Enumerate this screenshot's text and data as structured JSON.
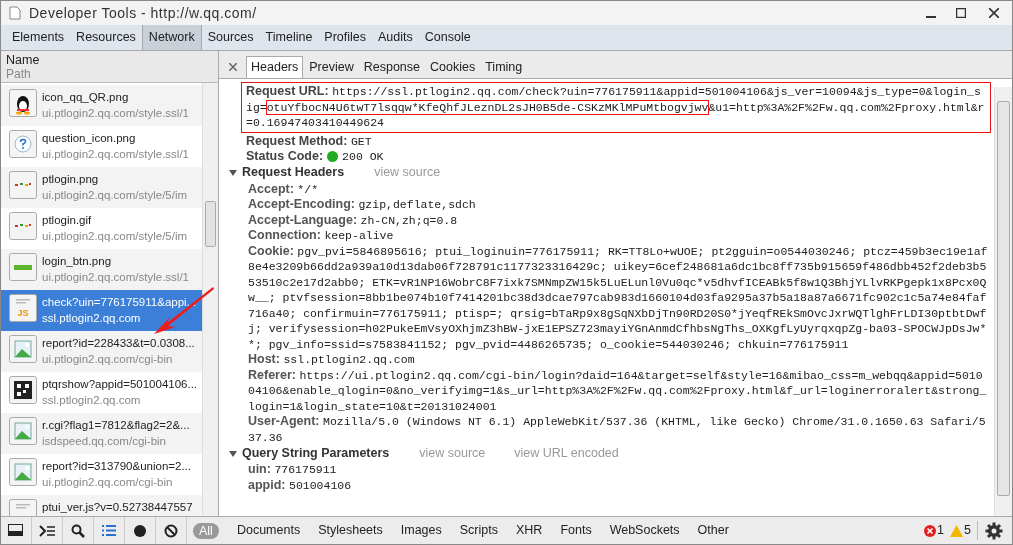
{
  "window": {
    "title": "Developer Tools - http://w.qq.com/"
  },
  "tabs": [
    {
      "label": "Elements",
      "selected": false
    },
    {
      "label": "Resources",
      "selected": false
    },
    {
      "label": "Network",
      "selected": true
    },
    {
      "label": "Sources",
      "selected": false
    },
    {
      "label": "Timeline",
      "selected": false
    },
    {
      "label": "Profiles",
      "selected": false
    },
    {
      "label": "Audits",
      "selected": false
    },
    {
      "label": "Console",
      "selected": false
    }
  ],
  "requests": {
    "header_name": "Name",
    "header_path": "Path",
    "items": [
      {
        "kind": "penguin",
        "name": "icon_qq_QR.png",
        "path": "ui.ptlogin2.qq.com/style.ssl/1",
        "selected": false
      },
      {
        "kind": "question",
        "name": "question_icon.png",
        "path": "ui.ptlogin2.qq.com/style.ssl/1",
        "selected": false
      },
      {
        "kind": "sprite",
        "name": "ptlogin.png",
        "path": "ui.ptlogin2.qq.com/style/5/im",
        "selected": false
      },
      {
        "kind": "sprite",
        "name": "ptlogin.gif",
        "path": "ui.ptlogin2.qq.com/style/5/im",
        "selected": false
      },
      {
        "kind": "bar",
        "name": "login_btn.png",
        "path": "ui.ptlogin2.qq.com/style.ssl/1",
        "selected": false
      },
      {
        "kind": "script",
        "icon_text": "JS",
        "name": "check?uin=776175911&appi...",
        "path": "ssl.ptlogin2.qq.com",
        "selected": true
      },
      {
        "kind": "image",
        "name": "report?id=228433&t=0.0308...",
        "path": "ui.ptlogin2.qq.com/cgi-bin",
        "selected": false
      },
      {
        "kind": "qr",
        "name": "ptqrshow?appid=501004106...",
        "path": "ssl.ptlogin2.qq.com",
        "selected": false
      },
      {
        "kind": "image",
        "name": "r.cgi?flag1=7812&flag2=2&...",
        "path": "isdspeed.qq.com/cgi-bin",
        "selected": false
      },
      {
        "kind": "image",
        "name": "report?id=313790&union=2...",
        "path": "ui.ptlogin2.qq.com/cgi-bin",
        "selected": false
      },
      {
        "kind": "script",
        "name": "ptui_ver.js?v=0.52738447557",
        "selected": false
      }
    ]
  },
  "detail_tabs": [
    {
      "label": "Headers",
      "selected": true
    },
    {
      "label": "Preview",
      "selected": false
    },
    {
      "label": "Response",
      "selected": false
    },
    {
      "label": "Cookies",
      "selected": false
    },
    {
      "label": "Timing",
      "selected": false
    }
  ],
  "general": {
    "url_label": "Request URL:",
    "url_parts": [
      {
        "text": "https://ssl.ptlogin2.qq.com/check?uin=776175911&appid=501004106&js_ver=10094&js_type=0&login_sig=",
        "highlighted": false
      },
      {
        "text": "otuYfbocN4U6twT7lsqqw*KfeQhfJLeznDL2sJH0B5de-CSKzMKlMPuMtbogvjwv",
        "highlighted": true
      },
      {
        "text": "&u1=http%3A%2F%2Fw.qq.com%2Fproxy.html&r=0.16947403410449624",
        "highlighted": false
      }
    ],
    "method_label": "Request Method:",
    "method": "GET",
    "status_label": "Status Code:",
    "status": "200 OK"
  },
  "request_headers": {
    "title": "Request Headers",
    "expanded": true,
    "link": "view source",
    "items": [
      {
        "name": "Accept:",
        "value": "*/*"
      },
      {
        "name": "Accept-Encoding:",
        "value": "gzip,deflate,sdch"
      },
      {
        "name": "Accept-Language:",
        "value": "zh-CN,zh;q=0.8"
      },
      {
        "name": "Connection:",
        "value": "keep-alive"
      },
      {
        "name": "Cookie:",
        "value": "pgv_pvi=5846895616; ptui_loginuin=776175911; RK=TT8Lo+wUOE; pt2gguin=o0544030246; ptcz=459b3ec19e1af8e4e3209b66dd2a939a10d13dab06f728791c1177323316429c; uikey=6cef248681a6dc1bc8ff735b915659f486dbb452f2deb3b553510c2e17d2abb0; ETK=vR1NP16WobrC8F7ixk7SMNmpZW15k5LuELunl0Vu0qc*v5dhvfICEABk5f8w1Q3BhjYLlvRKPgepk1x8Pcx0Qw__; ptvfsession=8bb1be074b10f7414201bc38d3dcae797cab983d1660104d03fa9295a37b5a18a87a6671fc902c1c5a74e84faf716a40; confirmuin=776175911; ptisp=; qrsig=bTaRp9x8gSqNXbDjTn90RD20S0*jYeqfREkSmOvcJxrWQTlghFrLDI30ptbtDwfj; verifysession=h02PukeEmVsyOXhjmZ3hBW-jxE1EPSZ723mayiYGnAnmdCfhbsNgThs_OXKgfLyUyrqxqpZg-ba03-SPOCWJpDsJw**; pgv_info=ssid=s7583841152; pgv_pvid=4486265735; o_cookie=544030246; chkuin=776175911"
      },
      {
        "name": "Host:",
        "value": "ssl.ptlogin2.qq.com"
      },
      {
        "name": "Referer:",
        "value": "https://ui.ptlogin2.qq.com/cgi-bin/login?daid=164&target=self&style=16&mibao_css=m_webqq&appid=501004106&enable_qlogin=0&no_verifyimg=1&s_url=http%3A%2F%2Fw.qq.com%2Fproxy.html&f_url=loginerroralert&strong_login=1&login_state=10&t=20131024001"
      },
      {
        "name": "User-Agent:",
        "value": "Mozilla/5.0 (Windows NT 6.1) AppleWebKit/537.36 (KHTML, like Gecko) Chrome/31.0.1650.63 Safari/537.36"
      }
    ]
  },
  "query_params": {
    "title": "Query String Parameters",
    "expanded": true,
    "links": [
      "view source",
      "view URL encoded"
    ],
    "items": [
      {
        "name": "uin:",
        "value": "776175911"
      },
      {
        "name": "appid:",
        "value": "501004106"
      }
    ]
  },
  "filters": [
    {
      "label": "All",
      "selected": true
    },
    {
      "label": "Documents",
      "selected": false
    },
    {
      "label": "Stylesheets",
      "selected": false
    },
    {
      "label": "Images",
      "selected": false
    },
    {
      "label": "Scripts",
      "selected": false
    },
    {
      "label": "XHR",
      "selected": false
    },
    {
      "label": "Fonts",
      "selected": false
    },
    {
      "label": "WebSockets",
      "selected": false
    },
    {
      "label": "Other",
      "selected": false
    }
  ],
  "errors": "1",
  "warnings": "5"
}
